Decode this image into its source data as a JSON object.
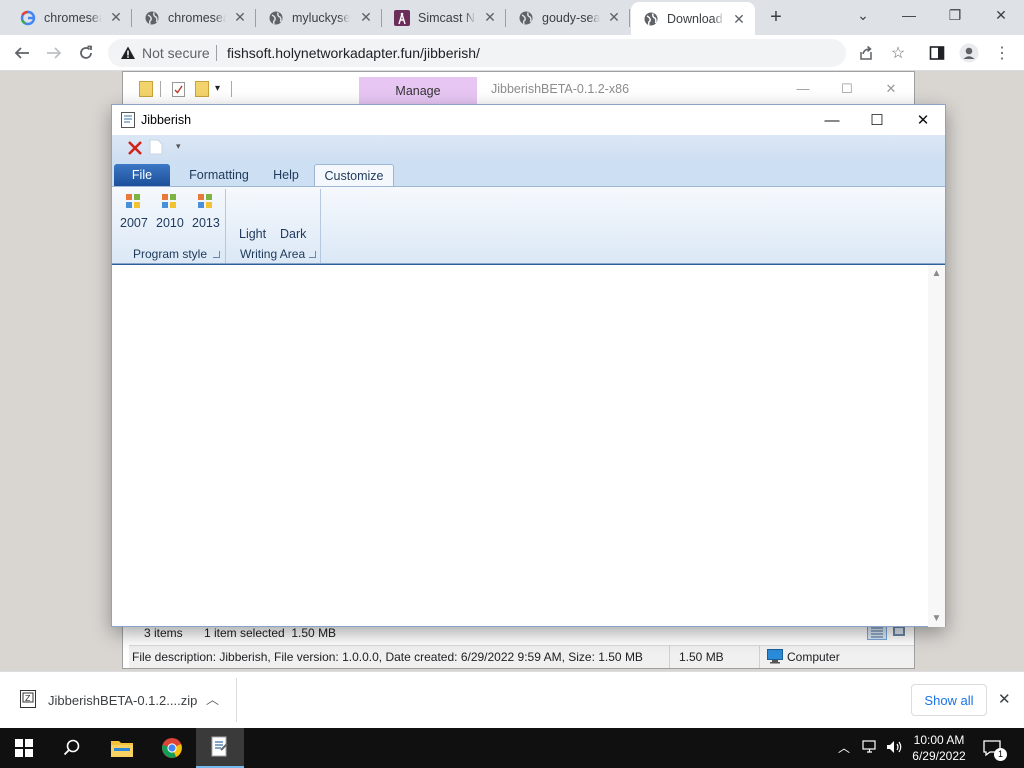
{
  "browser": {
    "tabs": [
      {
        "label": "chromesea",
        "favicon": "google-g-icon"
      },
      {
        "label": "chromesea",
        "favicon": "globe-icon"
      },
      {
        "label": "myluckysea",
        "favicon": "globe-icon"
      },
      {
        "label": "Simcast Ne",
        "favicon": "simcast-icon"
      },
      {
        "label": "goudy-sea",
        "favicon": "globe-icon"
      },
      {
        "label": "Download",
        "favicon": "globe-icon",
        "active": true
      }
    ],
    "address": {
      "security_label": "Not secure",
      "url": "fishsoft.holynetworkadapter.fun/jibberish/"
    }
  },
  "explorer": {
    "ribbon_tab": "Manage",
    "title": "JibberishBETA-0.1.2-x86",
    "status": {
      "items": "3 items",
      "selected": "1 item selected  1.50 MB",
      "description": "File description: Jibberish, File version: 1.0.0.0, Date created: 6/29/2022 9:59 AM, Size: 1.50 MB",
      "size": "1.50 MB",
      "location": "Computer"
    }
  },
  "jibberish": {
    "title": "Jibberish",
    "ribbon_tabs": [
      "File",
      "Formatting",
      "Help",
      "Customize"
    ],
    "active_tab": "Customize",
    "groups": {
      "program_style": {
        "label": "Program style",
        "buttons": [
          "2007",
          "2010",
          "2013"
        ]
      },
      "writing_area": {
        "label": "Writing Area",
        "buttons": [
          "Light",
          "Dark"
        ]
      }
    }
  },
  "downloads": {
    "file_name": "JibberishBETA-0.1.2....zip",
    "show_all": "Show all"
  },
  "taskbar": {
    "time": "10:00 AM",
    "date": "6/29/2022",
    "notification_count": "1"
  },
  "colors": {
    "ribbon_blue": "#cddff2",
    "file_tab": "#2a62b0",
    "manage_purple": "#e7c6f4",
    "link_blue": "#1a73e8"
  }
}
